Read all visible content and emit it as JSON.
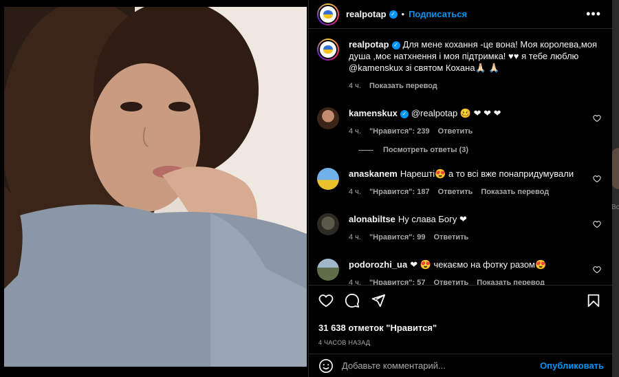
{
  "post": {
    "author": "realpotap",
    "dot": "•",
    "follow_label": "Подписаться",
    "more_label": "•••",
    "caption": "Для мене кохання -це вона! Моя королева,моя душа ,моє натхнення і моя підтримка! ♥♥ я тебе люблю @kamenskux зі святом Кохана🙏🏻 🙏🏻",
    "time": "4 ч.",
    "translate_label": "Показать перевод",
    "likes": "31 638 отметок \"Нравится\"",
    "ago": "4 ЧАСОВ НАЗАД"
  },
  "comments": [
    {
      "user": "kamenskux",
      "verified": true,
      "text": "@realpotap 🥴 ❤ ❤ ❤",
      "time": "4 ч.",
      "likes": "\"Нравится\": 239",
      "reply": "Ответить",
      "translate": ""
    },
    {
      "user": "anaskanem",
      "verified": false,
      "text": "Нарешті😍 а то всі вже понапридумували",
      "time": "4 ч.",
      "likes": "\"Нравится\": 187",
      "reply": "Ответить",
      "translate": "Показать перевод"
    },
    {
      "user": "alonabiltse",
      "verified": false,
      "text": "Ну слава Богу ❤",
      "time": "4 ч.",
      "likes": "\"Нравится\": 99",
      "reply": "Ответить",
      "translate": ""
    },
    {
      "user": "podorozhi_ua",
      "verified": false,
      "text": "❤ 😍 чекаємо на фотку разом😍",
      "time": "4 ч.",
      "likes": "\"Нравится\": 57",
      "reply": "Ответить",
      "translate": "Показать перевод"
    }
  ],
  "view_replies": "Посмотреть ответы (3)",
  "composer": {
    "placeholder": "Добавьте комментарий...",
    "publish": "Опубликовать"
  },
  "next_peek_text": "Во",
  "colors": {
    "accent": "#0095f6",
    "background": "#000000",
    "muted": "#a8a8a8",
    "heart": "#ed2a40"
  }
}
